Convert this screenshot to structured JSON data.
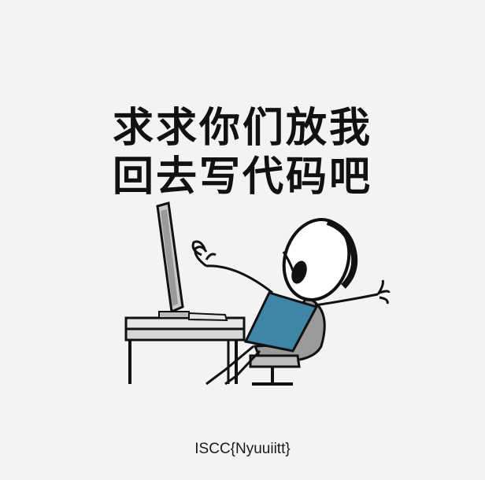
{
  "meme": {
    "caption_line1": "求求你们放我",
    "caption_line2": "回去写代码吧"
  },
  "flag_text": "ISCC{Nyuuiitt}",
  "colors": {
    "background": "#f3f3f3",
    "shirt": "#3f86a6",
    "outline": "#111111",
    "monitor": "#a9a9a9"
  }
}
